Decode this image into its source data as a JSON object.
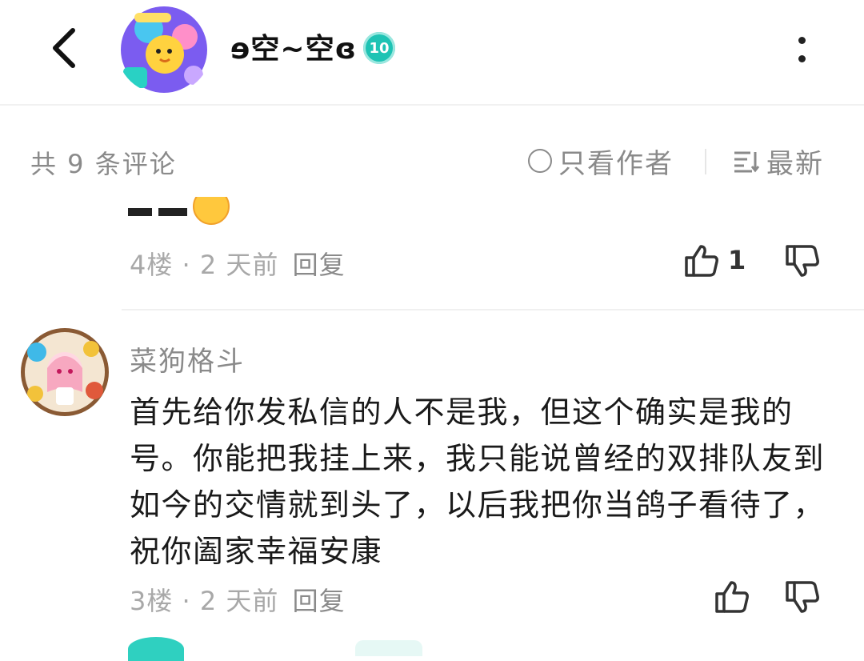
{
  "header": {
    "title": "ɘ空~空ɞ",
    "level": "10"
  },
  "filter": {
    "count_text": "共 9 条评论",
    "author_only": "只看作者",
    "sort_label": "最新"
  },
  "comments": [
    {
      "floor": "4楼",
      "time": "2 天前",
      "reply_label": "回复",
      "likes": "1"
    },
    {
      "username": "菜狗格斗",
      "body": "首先给你发私信的人不是我，但这个确实是我的号。你能把我挂上来，我只能说曾经的双排队友到如今的交情就到头了，以后我把你当鸽子看待了，祝你阖家幸福安康",
      "floor": "3楼",
      "time": "2 天前",
      "reply_label": "回复",
      "likes": ""
    }
  ],
  "colors": {
    "accent": "#1ec3b4",
    "muted_text": "#8a8a8a",
    "light_text": "#a8a8a8"
  }
}
